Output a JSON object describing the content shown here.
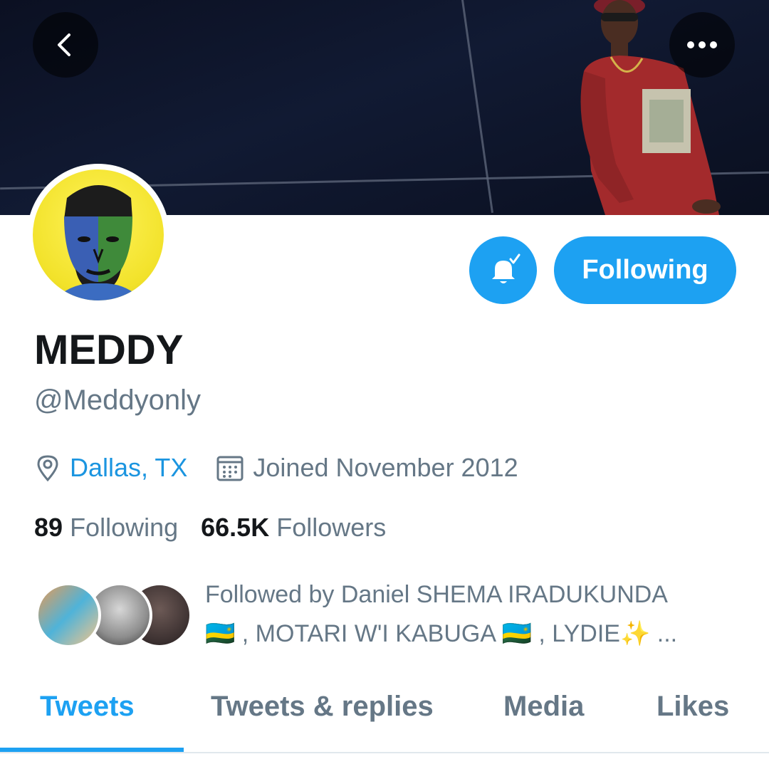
{
  "profile": {
    "display_name": "MEDDY",
    "handle": "@Meddyonly",
    "location": "Dallas, TX",
    "joined": "Joined November 2012",
    "following_count": "89",
    "following_label": "Following",
    "followers_count": "66.5K",
    "followers_label": "Followers"
  },
  "actions": {
    "follow_state_label": "Following",
    "notifications_icon": "bell-check-icon",
    "back_icon": "chevron-left-icon",
    "more_icon": "more-horizontal-icon"
  },
  "followed_by": {
    "line1": "Followed by Daniel SHEMA IRADUKUNDA",
    "line2": "🇷🇼 , MOTARI W'I KABUGA 🇷🇼 , LYDIE✨ ..."
  },
  "tabs": [
    {
      "label": "Tweets",
      "active": true
    },
    {
      "label": "Tweets & replies",
      "active": false
    },
    {
      "label": "Media",
      "active": false
    },
    {
      "label": "Likes",
      "active": false
    }
  ],
  "colors": {
    "accent": "#1da1f2",
    "link": "#1b95e0",
    "muted": "#657786",
    "text": "#14171a"
  }
}
